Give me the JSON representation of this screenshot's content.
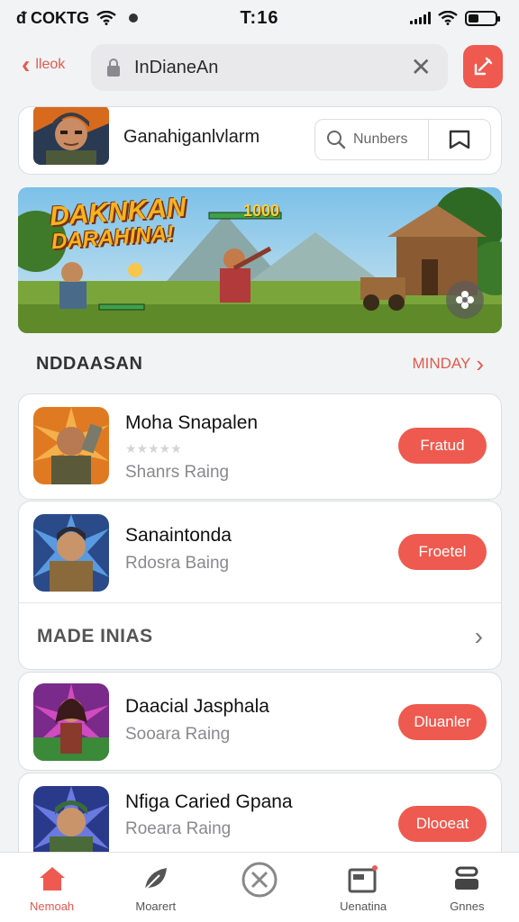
{
  "status_bar": {
    "carrier": "ᵭ COKTG",
    "network": "",
    "time": "T:16"
  },
  "top_bar": {
    "back_label": "lleok",
    "search_value": "InDianeAn"
  },
  "profile": {
    "name": "Ganahiganlvlarm",
    "numbers_label": "Nunbers"
  },
  "banner": {
    "title_line1": "DAKNKAN",
    "title_line2": "DARAHINA!",
    "score": "1000"
  },
  "section": {
    "title": "NDDAASAN",
    "link": "MINDAY"
  },
  "apps": [
    {
      "name": "Moha Snapalen",
      "sub": "Shanrs Raing",
      "button": "Fratud",
      "stars": "★★★★★"
    },
    {
      "name": "Sanaintonda",
      "sub": "Rdosra Baing",
      "button": "Froetel"
    },
    {
      "name": "Daacial Jasphala",
      "sub": "Sooara Raing",
      "button": "Dluanler"
    },
    {
      "name": "Nfiga Caried Gpana",
      "sub": "Roeara Raing",
      "button": "Dlooeat"
    }
  ],
  "made_row": {
    "title": "MADE INIAS"
  },
  "tabs": [
    {
      "label": "Nemoah",
      "icon": "home-icon"
    },
    {
      "label": "Moarert",
      "icon": "leaf-icon"
    },
    {
      "label": "",
      "icon": "close-circle-icon"
    },
    {
      "label": "Uenatina",
      "icon": "window-icon"
    },
    {
      "label": "Gnnes",
      "icon": "stack-icon"
    }
  ],
  "colors": {
    "accent": "#ee5a4f",
    "background": "#f2f3f5"
  }
}
